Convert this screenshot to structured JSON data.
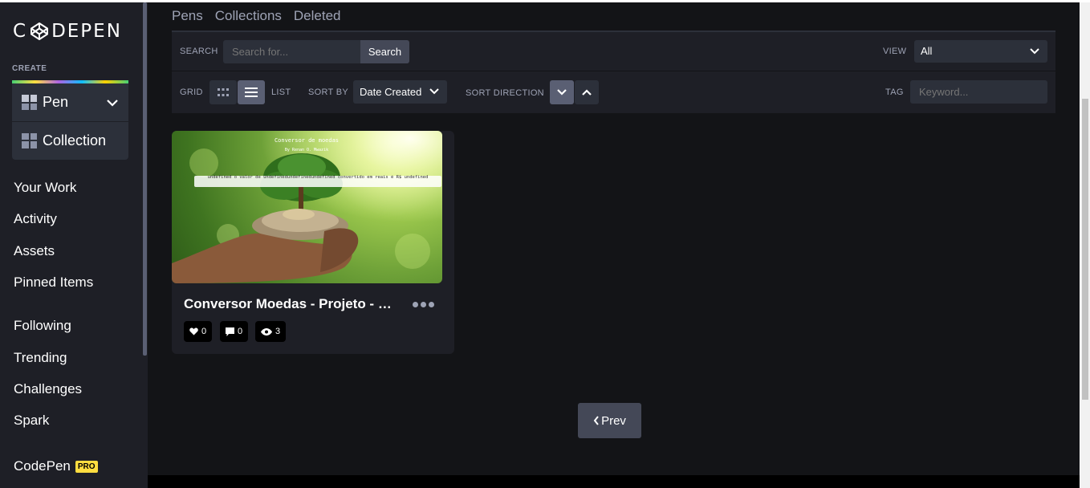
{
  "sidebar": {
    "logo": "CODEPEN",
    "create_label": "CREATE",
    "create_items": [
      {
        "label": "Pen"
      },
      {
        "label": "Collection"
      }
    ],
    "nav_items": [
      {
        "label": "Your Work"
      },
      {
        "label": "Activity"
      },
      {
        "label": "Assets"
      },
      {
        "label": "Pinned Items"
      },
      {
        "label": "Following"
      },
      {
        "label": "Trending"
      },
      {
        "label": "Challenges"
      },
      {
        "label": "Spark"
      }
    ],
    "codepen_label": "CodePen",
    "pro_badge": "PRO"
  },
  "tabs": [
    {
      "label": "Pens"
    },
    {
      "label": "Collections"
    },
    {
      "label": "Deleted"
    }
  ],
  "filters": {
    "search_label": "SEARCH",
    "search_placeholder": "Search for...",
    "search_button": "Search",
    "view_label": "VIEW",
    "view_value": "All",
    "grid_label": "GRID",
    "list_label": "LIST",
    "sort_by_label": "SORT BY",
    "sort_by_value": "Date Created",
    "sort_direction_label": "SORT DIRECTION",
    "tag_label": "TAG",
    "tag_placeholder": "Keyword..."
  },
  "card": {
    "preview_title": "Conversor de moedas",
    "preview_author": "By Renan O. Mwazik",
    "preview_result": "undefined o valor de undefinedundefinedundefined convertido em reais é R$ undefined",
    "title": "Conversor Moedas - Projeto - 6...",
    "likes": "0",
    "comments": "0",
    "views": "3"
  },
  "pagination": {
    "prev_label": "Prev"
  },
  "colors": {
    "accent_yellow": "#ffdd40",
    "sidebar_bg": "#1e1f26",
    "main_bg": "#131417",
    "active_button": "#5a5f73"
  }
}
